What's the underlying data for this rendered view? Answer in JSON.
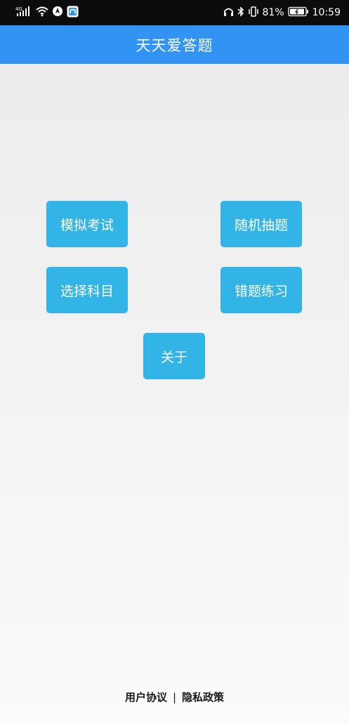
{
  "status_bar": {
    "network": "4G",
    "battery_percent": "81%",
    "time": "10:59"
  },
  "app_bar": {
    "title": "天天爱答题"
  },
  "menu": {
    "mock_exam": "模拟考试",
    "random_question": "随机抽题",
    "choose_subject": "选择科目",
    "wrong_practice": "错题练习",
    "about": "关于"
  },
  "footer": {
    "user_agreement": "用户协议",
    "separator": "|",
    "privacy_policy": "隐私政策"
  },
  "colors": {
    "status_bar": "#0c0c0c",
    "app_bar": "#3193f2",
    "button": "#32b4e6",
    "button_text": "#ffffff"
  },
  "icons": {
    "signal": "signal-icon",
    "wifi": "wifi-icon",
    "location": "location-icon",
    "app_notify": "app-notification-icon",
    "headphones": "headphones-icon",
    "bluetooth": "bluetooth-icon",
    "vibrate": "vibrate-icon",
    "battery": "battery-icon"
  }
}
